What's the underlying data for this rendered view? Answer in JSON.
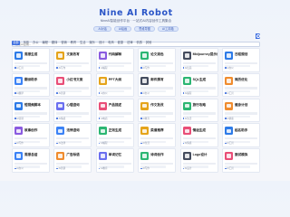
{
  "header": {
    "logo": "Nine AI Robot",
    "tagline": "NineAI智能创作平台 · 一站式AI内容创作工具集合"
  },
  "pills": [
    "AI对话",
    "AI绘画",
    "思维导图",
    "AI工具箱"
  ],
  "search": {
    "placeholder": "搜索AI应用..."
  },
  "categories": [
    {
      "label": "全部",
      "active": true
    },
    {
      "label": "写作"
    },
    {
      "label": "办公"
    },
    {
      "label": "编程"
    },
    {
      "label": "翻译"
    },
    {
      "label": "营销"
    },
    {
      "label": "教育"
    },
    {
      "label": "生活"
    },
    {
      "label": "娱乐"
    },
    {
      "label": "设计"
    },
    {
      "label": "电商"
    },
    {
      "label": "健康"
    },
    {
      "label": "法律"
    },
    {
      "label": "情感"
    },
    {
      "label": "其他"
    }
  ],
  "cards": [
    {
      "title": "周报生成",
      "foot": "AI工具",
      "color": "#2d7be8"
    },
    {
      "title": "文案改写",
      "foot": "AI写作",
      "color": "#e5a41b"
    },
    {
      "title": "代码解释",
      "foot": "AI编程",
      "color": "#8a5be0"
    },
    {
      "title": "论文润色",
      "foot": "AI写作",
      "color": "#2bb673"
    },
    {
      "title": "Midjourney提示词",
      "foot": "AI绘画",
      "color": "#444c5e"
    },
    {
      "title": "日程规划",
      "foot": "AI办公",
      "color": "#2d7be8"
    },
    {
      "title": "翻译助手",
      "foot": "AI翻译",
      "color": "#3b82f6"
    },
    {
      "title": "小红书文案",
      "foot": "AI营销",
      "color": "#e94e77"
    },
    {
      "title": "PPT大纲",
      "foot": "AI办公",
      "color": "#e5a41b"
    },
    {
      "title": "邮件撰写",
      "foot": "AI办公",
      "color": "#444c5e"
    },
    {
      "title": "SQL生成",
      "foot": "AI编程",
      "color": "#2bb673"
    },
    {
      "title": "简历优化",
      "foot": "AI工具",
      "color": "#f08c2e"
    },
    {
      "title": "短视频脚本",
      "foot": "AI营销",
      "color": "#2d7be8"
    },
    {
      "title": "心理咨询",
      "foot": "AI情感",
      "color": "#6b6ff0"
    },
    {
      "title": "产品描述",
      "foot": "AI电商",
      "color": "#e94e77"
    },
    {
      "title": "作文批改",
      "foot": "AI教育",
      "color": "#e5a41b"
    },
    {
      "title": "旅行攻略",
      "foot": "AI生活",
      "color": "#2bb673"
    },
    {
      "title": "健身计划",
      "foot": "AI健康",
      "color": "#f08c2e"
    },
    {
      "title": "故事创作",
      "foot": "AI写作",
      "color": "#8a5be0"
    },
    {
      "title": "法律咨询",
      "foot": "AI法律",
      "color": "#3b82f6"
    },
    {
      "title": "正则生成",
      "foot": "AI编程",
      "color": "#2bb673"
    },
    {
      "title": "菜谱推荐",
      "foot": "AI生活",
      "color": "#e5a41b"
    },
    {
      "title": "情话生成",
      "foot": "AI情感",
      "color": "#e94e77"
    },
    {
      "title": "起名助手",
      "foot": "AI工具",
      "color": "#2d7be8"
    },
    {
      "title": "周报总结",
      "foot": "AI办公",
      "color": "#3b82f6"
    },
    {
      "title": "广告标语",
      "foot": "AI营销",
      "color": "#f08c2e"
    },
    {
      "title": "单词记忆",
      "foot": "AI教育",
      "color": "#6b6ff0"
    },
    {
      "title": "诗词创作",
      "foot": "AI写作",
      "color": "#2bb673"
    },
    {
      "title": "Logo设计",
      "foot": "AI设计",
      "color": "#444c5e"
    },
    {
      "title": "面试模拟",
      "foot": "AI工具",
      "color": "#e94e77"
    }
  ]
}
